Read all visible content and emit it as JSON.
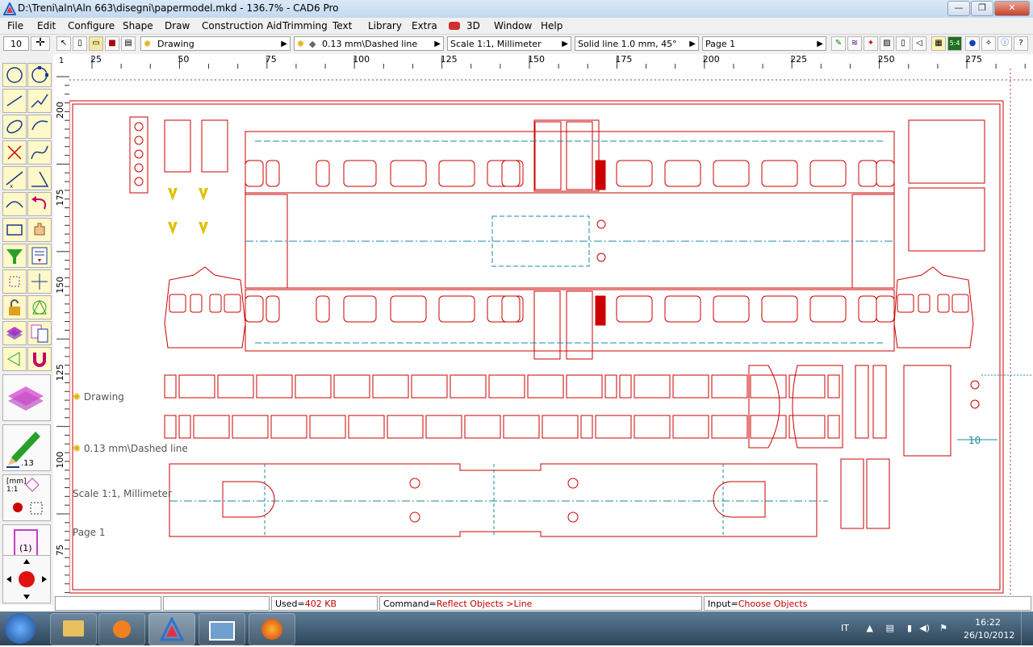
{
  "window": {
    "title": "D:\\Treni\\aln\\Aln 663\\disegni\\papermodel.mkd - 136.7% - CAD6 Pro",
    "min_label": "—",
    "max_label": "❐",
    "close_label": "✕"
  },
  "menu": [
    "File",
    "Edit",
    "Configure",
    "Shape",
    "Draw",
    "Construction Aid",
    "Trimming",
    "Text",
    "Library",
    "Extra",
    "3D",
    "Window",
    "Help"
  ],
  "toolbar": {
    "grid_value": "10",
    "layer": "Drawing",
    "pen": "0.13 mm\\Dashed line",
    "scale": "Scale 1:1, Millimeter",
    "fill": "Solid line 1.0 mm, 45°",
    "page": "Page 1"
  },
  "ruler_top": [
    "25",
    "50",
    "75",
    "100",
    "125",
    "150",
    "175",
    "200",
    "225",
    "250",
    "275"
  ],
  "ruler_left": [
    "200",
    "175",
    "150",
    "125",
    "100",
    "75"
  ],
  "ruler_corner": "1",
  "canvas_labels": {
    "layer": "Drawing",
    "pen": "0.13 mm\\Dashed line",
    "scale": "Scale 1:1, Millimeter",
    "page": "Page 1",
    "dim": "10"
  },
  "left_panel": {
    "pen_width": ".13",
    "scale_label": "[mm] 1:1",
    "page_label": "(1)"
  },
  "status": {
    "used_label": "Used=",
    "used_value": "402 KB",
    "command_label": "Command=",
    "command_value": "Reflect Objects >Line",
    "input_label": "Input=",
    "input_value": "Choose Objects"
  },
  "taskbar": {
    "lang": "IT",
    "time": "16:22",
    "date": "26/10/2012"
  },
  "colors": {
    "drawing": "#cc0000",
    "construction": "#1a8aa0",
    "accent": "#1e5c9c"
  }
}
